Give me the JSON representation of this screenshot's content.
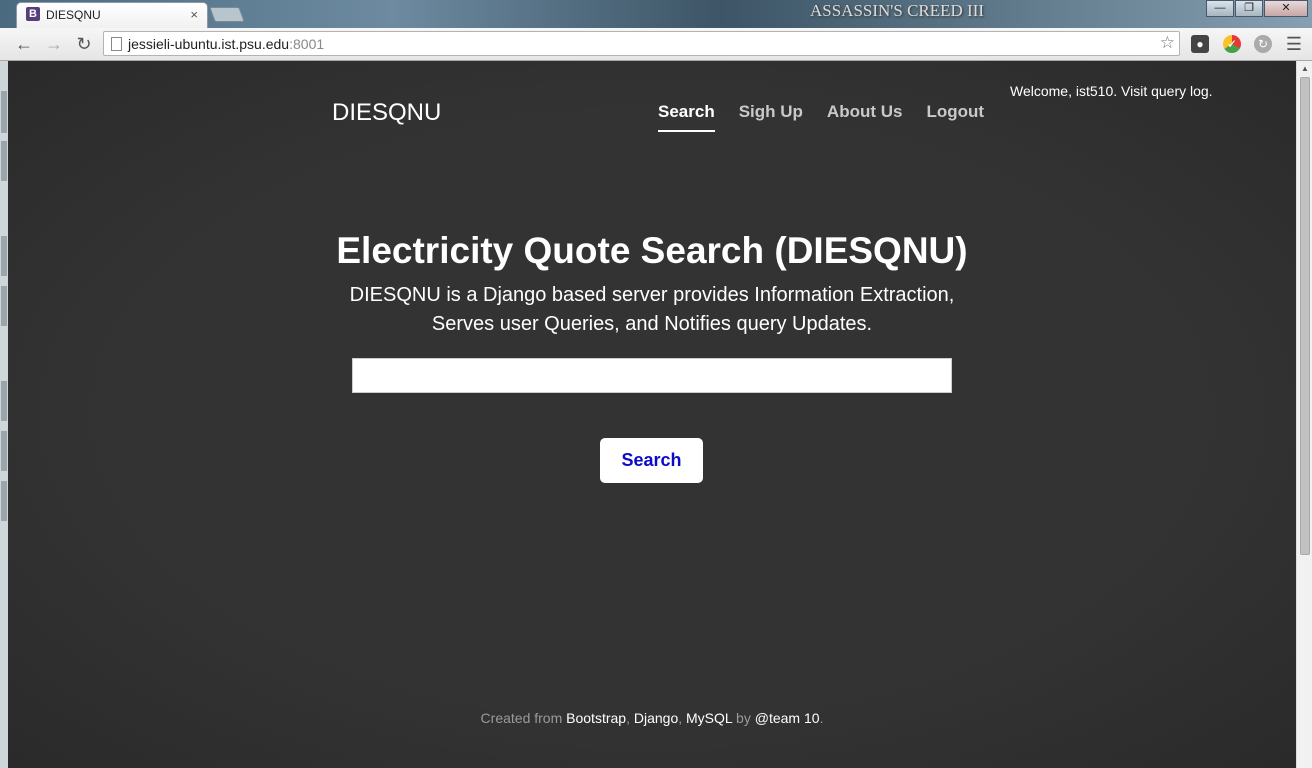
{
  "browser": {
    "tab_title": "DIESQNU",
    "tab_favicon": "B",
    "tab_close": "×",
    "background_logo": "ASSASSIN'S CREED III",
    "url_host": "jessieli-ubuntu.ist.psu.edu",
    "url_port": ":8001",
    "back_icon": "back-arrow-icon",
    "forward_icon": "forward-arrow-icon",
    "reload_icon": "reload-icon",
    "bookmark_icon": "star-icon"
  },
  "site": {
    "brand": "DIESQNU",
    "nav": [
      {
        "label": "Search",
        "active": true
      },
      {
        "label": "Sigh Up",
        "active": false
      },
      {
        "label": "About Us",
        "active": false
      },
      {
        "label": "Logout",
        "active": false
      }
    ],
    "welcome": "Welcome, ist510. Visit query log."
  },
  "hero": {
    "title": "Electricity Quote Search (DIESQNU)",
    "description_line1": "DIESQNU is a Django based server provides Information Extraction,",
    "description_line2": "Serves user Queries, and Notifies query Updates.",
    "search_value": "",
    "search_button": "Search"
  },
  "footer": {
    "created_from": "Created from ",
    "bootstrap": "Bootstrap",
    "comma1": ", ",
    "django": "Django",
    "comma2": ", ",
    "mysql": "MySQL",
    "by": " by ",
    "team": "@team 10",
    "period": "."
  },
  "colors": {
    "page_bg": "#333333",
    "button_text": "#0b0bc8"
  }
}
